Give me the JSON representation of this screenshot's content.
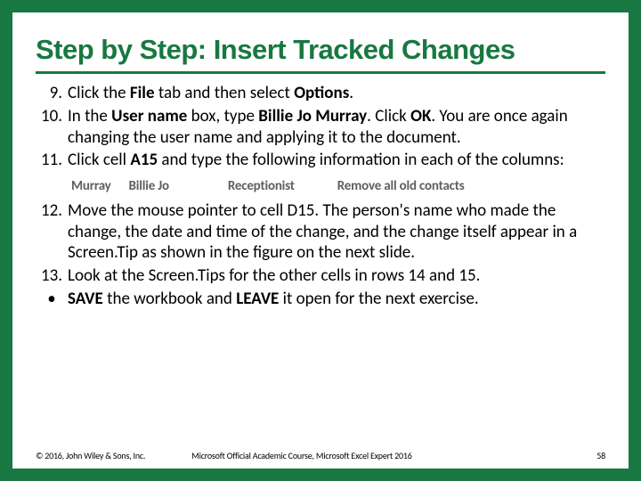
{
  "title": "Step by Step: Insert Tracked Changes",
  "steps": {
    "s9_num": "9.",
    "s9_a": "Click the ",
    "s9_b": "File",
    "s9_c": " tab and then select ",
    "s9_d": "Options",
    "s9_e": ".",
    "s10_num": "10.",
    "s10_a": "In the ",
    "s10_b": "User name",
    "s10_c": " box, type ",
    "s10_d": "Billie Jo Murray",
    "s10_e": ". Click ",
    "s10_f": "OK",
    "s10_g": ". You are once again changing the user name and applying it to the document.",
    "s11_num": "11.",
    "s11_a": "Click cell ",
    "s11_b": "A15",
    "s11_c": " and type the following information in each of the columns:",
    "s12_num": "12.",
    "s12_a": "Move the mouse pointer to cell D15. The person's name who made the change, the date and time of the change, and the change itself appear in a Screen.Tip as shown in the figure on the next slide.",
    "s13_num": "13.",
    "s13_a": "Look at the Screen.Tips for the other cells in rows 14 and 15.",
    "bullet": "•",
    "save_a": "SAVE",
    "save_b": " the workbook and ",
    "save_c": "LEAVE",
    "save_d": " it open for the next exercise."
  },
  "table_row": {
    "c1": "Murray",
    "c2": "Billie Jo",
    "c3": "Receptionist",
    "c4": "Remove all old contacts"
  },
  "footer": {
    "copyright": "© 2016, John Wiley & Sons, Inc.",
    "course": "Microsoft Official Academic Course, Microsoft Excel Expert 2016",
    "page": "58"
  }
}
